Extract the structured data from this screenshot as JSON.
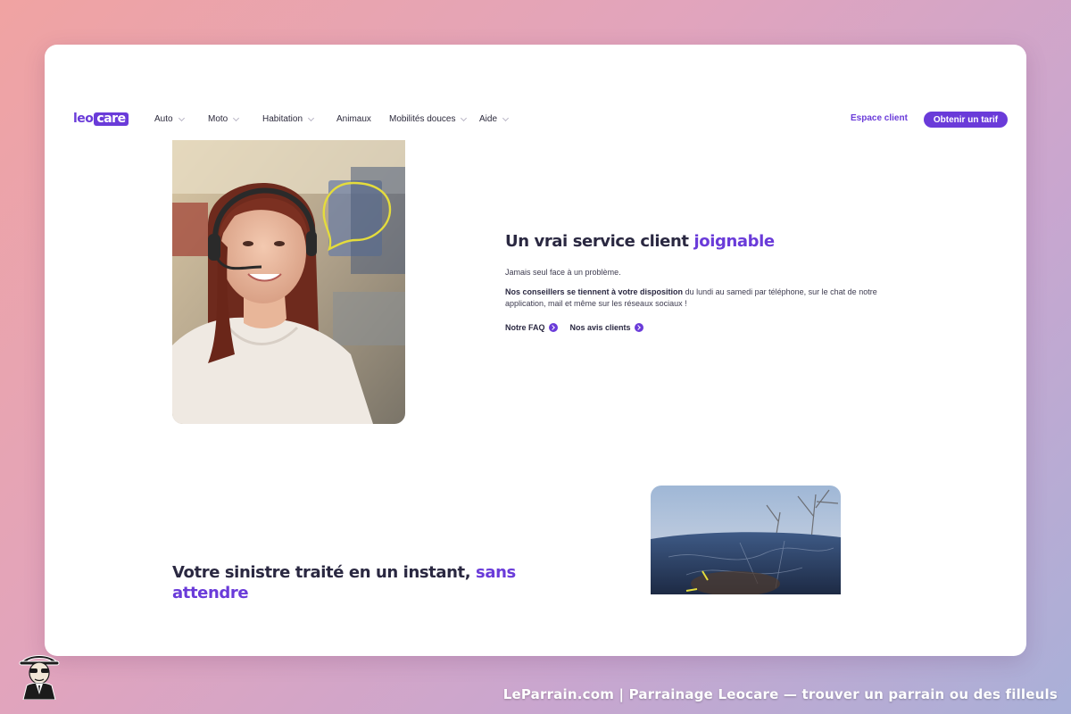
{
  "header": {
    "logo": {
      "part1": "leo",
      "part2": "care"
    },
    "nav": [
      {
        "label": "Auto",
        "dropdown": true
      },
      {
        "label": "Moto",
        "dropdown": true
      },
      {
        "label": "Habitation",
        "dropdown": true
      },
      {
        "label": "Animaux",
        "dropdown": false
      },
      {
        "label": "Mobilités douces",
        "dropdown": true
      },
      {
        "label": "Aide",
        "dropdown": true
      }
    ],
    "client_space": "Espace client",
    "cta": "Obtenir un tarif"
  },
  "section1": {
    "title_plain": "Un vrai service client ",
    "title_accent": "joignable",
    "intro": "Jamais seul face à un problème.",
    "body_bold": "Nos conseillers se tiennent à votre disposition",
    "body_rest": " du lundi au samedi par téléphone, sur le chat de notre application, mail et même sur les réseaux sociaux !",
    "links": [
      "Notre FAQ",
      "Nos avis clients"
    ]
  },
  "section2": {
    "title_plain": "Votre sinistre traité en un instant, ",
    "title_accent": "sans attendre"
  },
  "footer": {
    "caption": "LeParrain.com | Parrainage Leocare — trouver un parrain ou des filleuls"
  },
  "colors": {
    "brand": "#6a3bd9",
    "heading": "#2a2841",
    "yellow_accent": "#e4dc3c"
  }
}
